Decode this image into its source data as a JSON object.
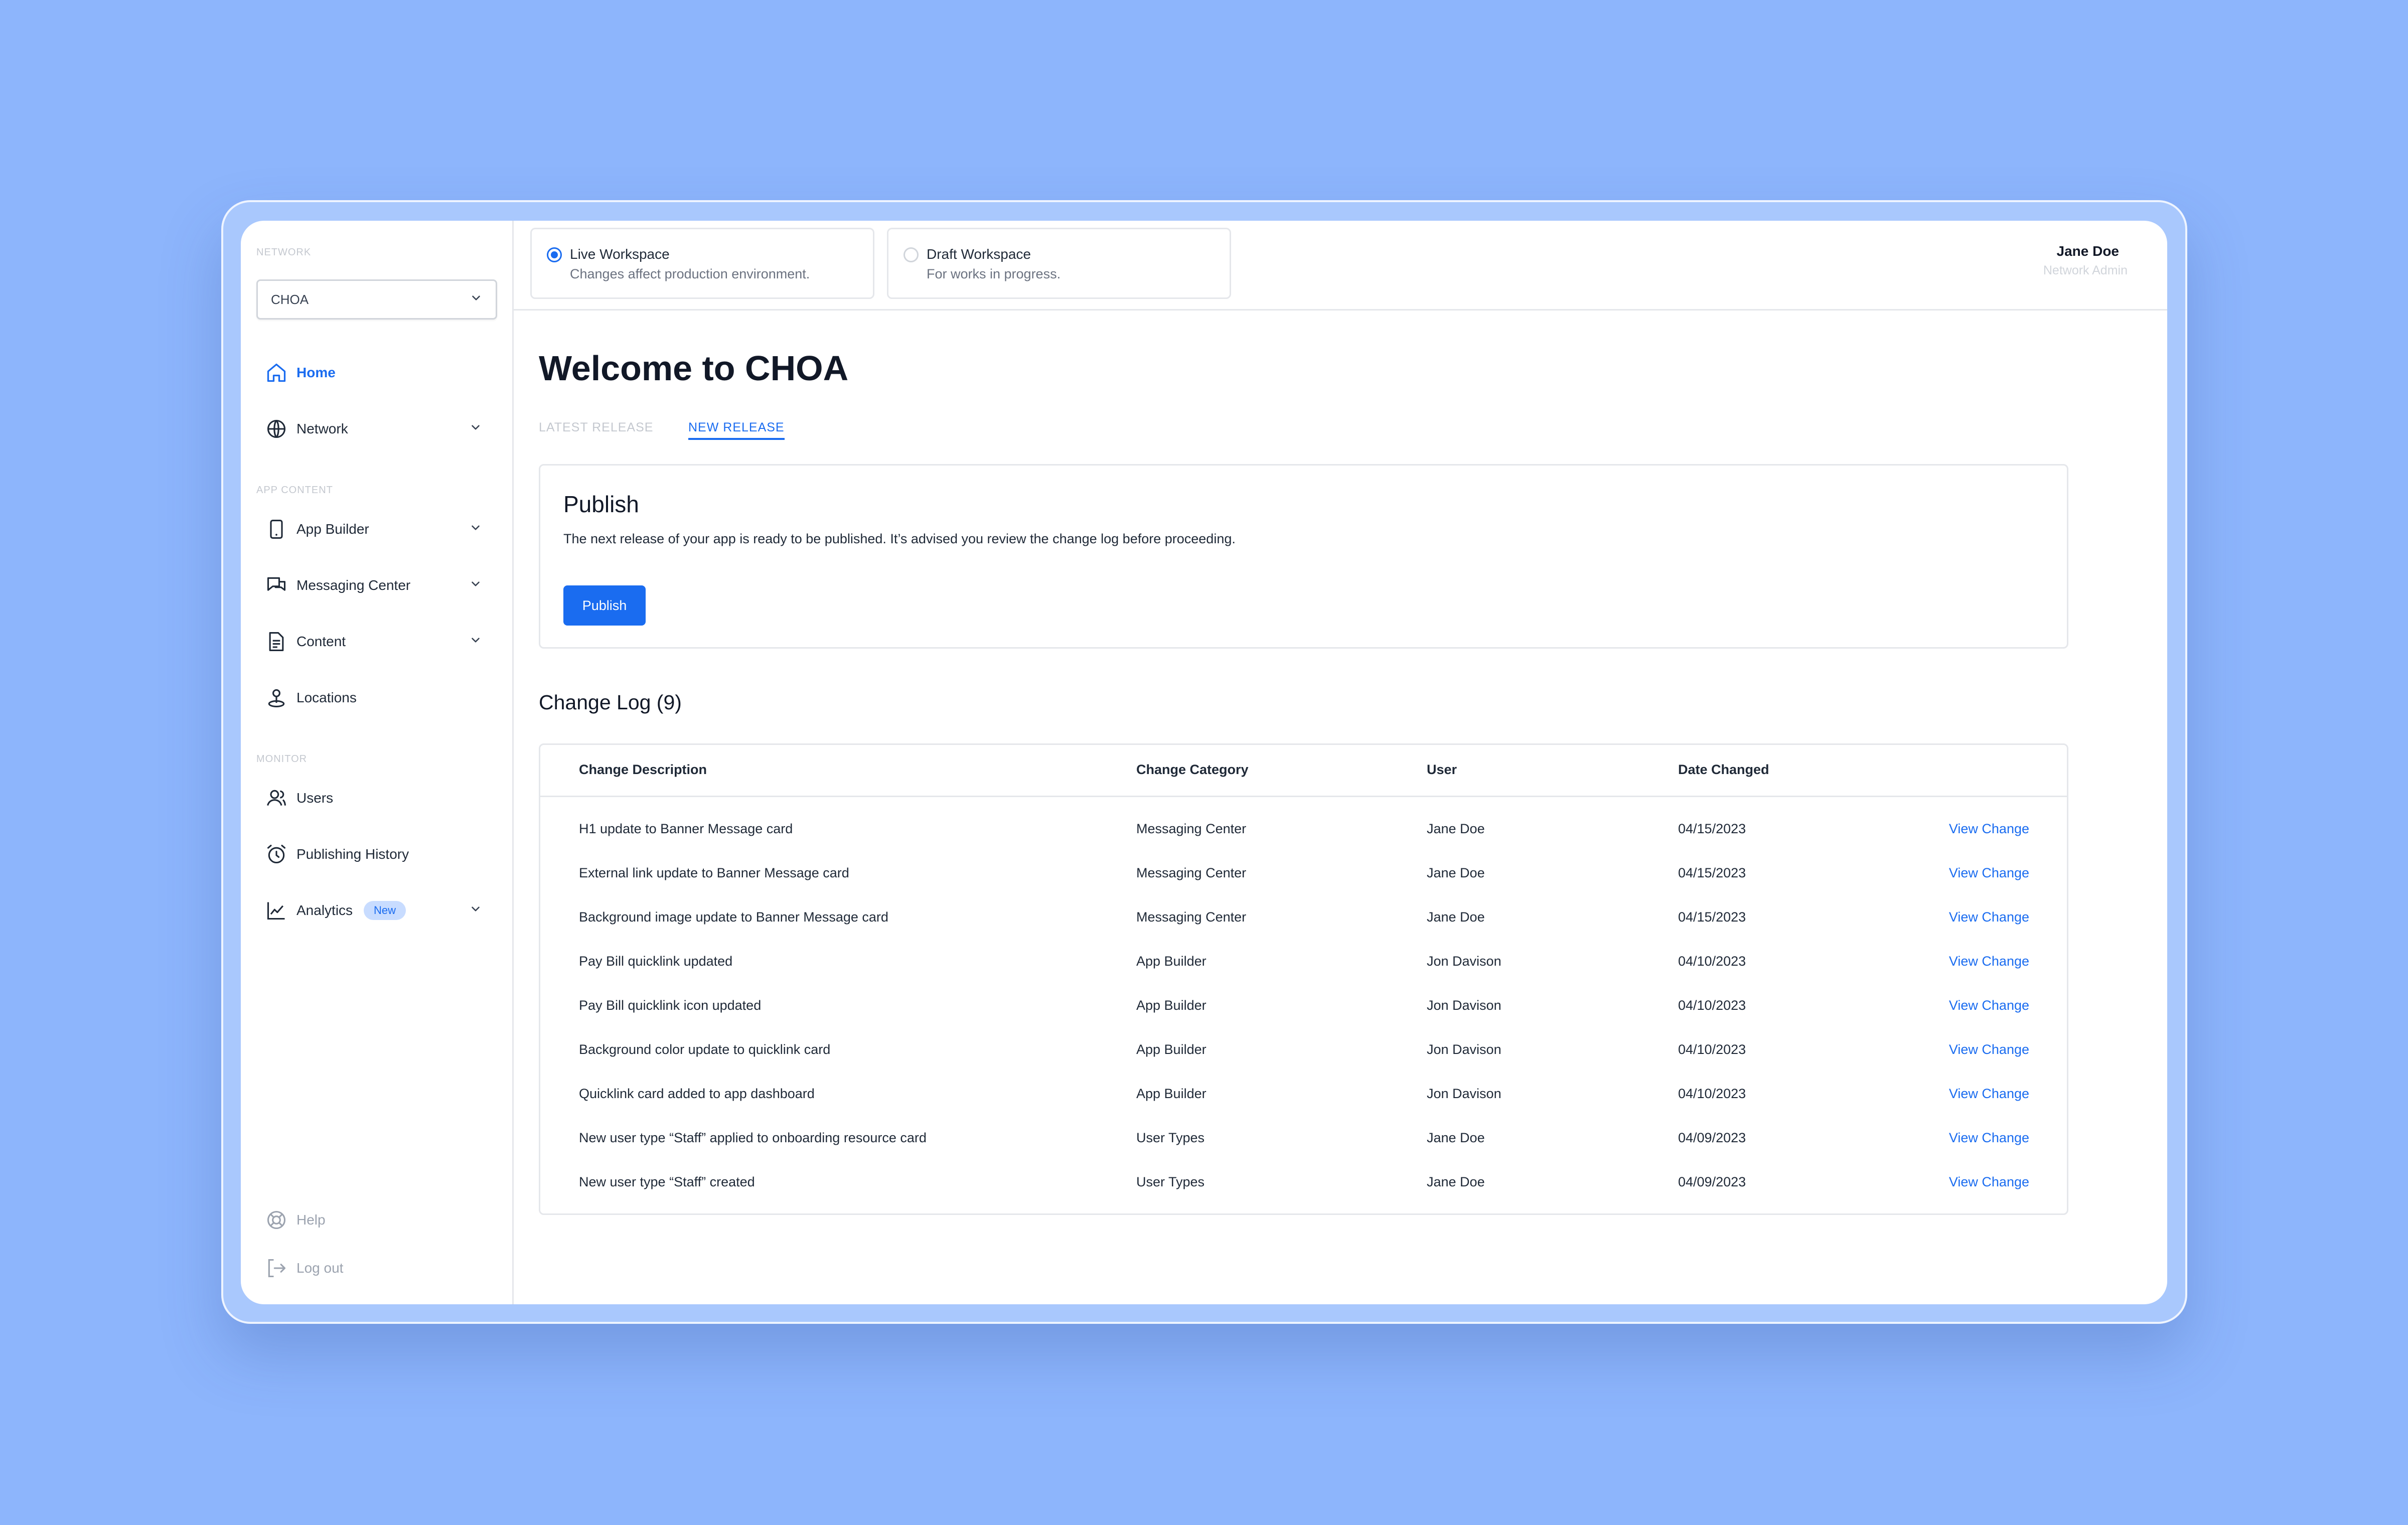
{
  "sidebar": {
    "network_label": "NETWORK",
    "network_value": "CHOA",
    "home": "Home",
    "network": "Network",
    "app_content_label": "APP CONTENT",
    "app_builder": "App Builder",
    "messaging_center": "Messaging Center",
    "content": "Content",
    "locations": "Locations",
    "monitor_label": "MONITOR",
    "users": "Users",
    "publishing_history": "Publishing History",
    "analytics": "Analytics",
    "analytics_badge": "New",
    "help": "Help",
    "logout": "Log out"
  },
  "topbar": {
    "live_title": "Live Workspace",
    "live_sub": "Changes affect production environment.",
    "draft_title": "Draft Workspace",
    "draft_sub": "For works in progress.",
    "user_name": "Jane Doe",
    "user_role": "Network Admin"
  },
  "main": {
    "title": "Welcome to CHOA",
    "tab_latest": "LATEST RELEASE",
    "tab_new": "NEW RELEASE",
    "publish_heading": "Publish",
    "publish_desc": "The next release of your app is ready to be published. It’s advised you review the change log before proceeding.",
    "publish_button": "Publish",
    "changelog_title": "Change Log (9)"
  },
  "table": {
    "headers": [
      "Change Description",
      "Change Category",
      "User",
      "Date Changed"
    ],
    "link_label": "View Change",
    "rows": [
      {
        "desc": "H1 update to Banner Message card",
        "category": "Messaging Center",
        "user": "Jane Doe",
        "date": "04/15/2023"
      },
      {
        "desc": "External link update to Banner Message card",
        "category": "Messaging Center",
        "user": "Jane Doe",
        "date": "04/15/2023"
      },
      {
        "desc": "Background image update to Banner Message card",
        "category": "Messaging Center",
        "user": "Jane Doe",
        "date": "04/15/2023"
      },
      {
        "desc": "Pay Bill quicklink updated",
        "category": "App Builder",
        "user": "Jon Davison",
        "date": "04/10/2023"
      },
      {
        "desc": "Pay Bill quicklink icon updated",
        "category": "App Builder",
        "user": "Jon Davison",
        "date": "04/10/2023"
      },
      {
        "desc": "Background color update to quicklink card",
        "category": "App Builder",
        "user": "Jon Davison",
        "date": "04/10/2023"
      },
      {
        "desc": "Quicklink card added to app dashboard",
        "category": "App Builder",
        "user": "Jon Davison",
        "date": "04/10/2023"
      },
      {
        "desc": "New user type “Staff” applied to onboarding resource card",
        "category": "User Types",
        "user": "Jane Doe",
        "date": "04/09/2023"
      },
      {
        "desc": "New user type “Staff” created",
        "category": "User Types",
        "user": "Jane Doe",
        "date": "04/09/2023"
      }
    ]
  },
  "colors": {
    "accent": "#1a6cf0",
    "background": "#8db5fc"
  }
}
